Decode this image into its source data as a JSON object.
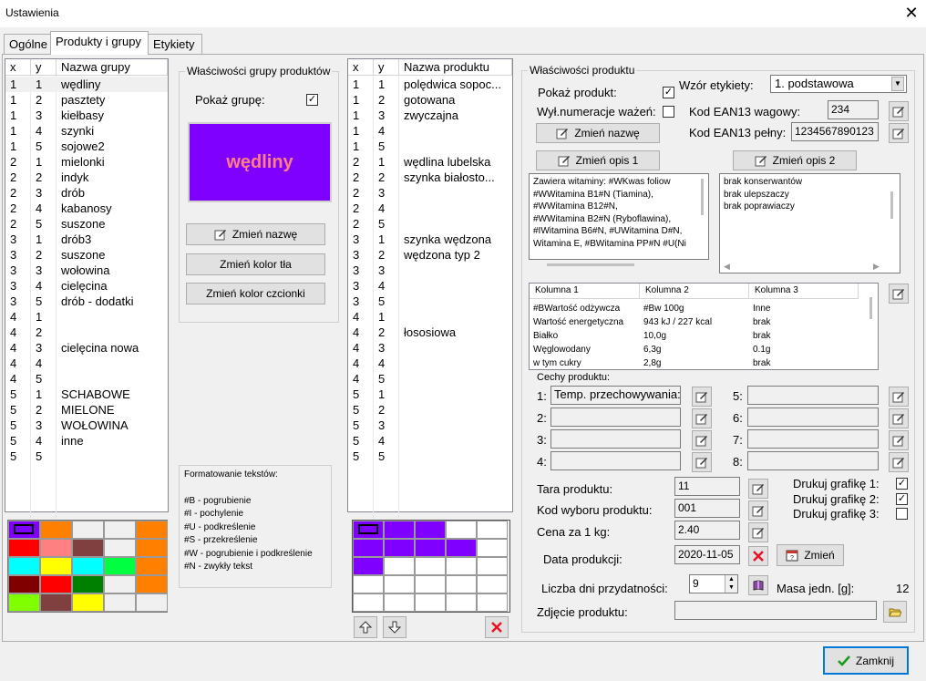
{
  "window": {
    "title": "Ustawienia",
    "close_glyph": "✕"
  },
  "tabs": [
    "Ogólne",
    "Produkty i grupy",
    "Etykiety"
  ],
  "groups_grid": {
    "headers": [
      "x",
      "y",
      "Nazwa grupy"
    ],
    "rows": [
      [
        "1",
        "1",
        "wędliny"
      ],
      [
        "1",
        "2",
        "pasztety"
      ],
      [
        "1",
        "3",
        "kiełbasy"
      ],
      [
        "1",
        "4",
        "szynki"
      ],
      [
        "1",
        "5",
        "sojowe2"
      ],
      [
        "2",
        "1",
        "mielonki"
      ],
      [
        "2",
        "2",
        "indyk"
      ],
      [
        "2",
        "3",
        "drób"
      ],
      [
        "2",
        "4",
        "kabanosy"
      ],
      [
        "2",
        "5",
        "suszone"
      ],
      [
        "3",
        "1",
        "drób3"
      ],
      [
        "3",
        "2",
        "suszone"
      ],
      [
        "3",
        "3",
        "wołowina"
      ],
      [
        "3",
        "4",
        "cielęcina"
      ],
      [
        "3",
        "5",
        "drób - dodatki"
      ],
      [
        "4",
        "1",
        ""
      ],
      [
        "4",
        "2",
        ""
      ],
      [
        "4",
        "3",
        "cielęcina nowa"
      ],
      [
        "4",
        "4",
        ""
      ],
      [
        "4",
        "5",
        ""
      ],
      [
        "5",
        "1",
        "SCHABOWE"
      ],
      [
        "5",
        "2",
        "MIELONE"
      ],
      [
        "5",
        "3",
        "WOŁOWINA"
      ],
      [
        "5",
        "4",
        "inne"
      ],
      [
        "5",
        "5",
        ""
      ]
    ]
  },
  "group_props": {
    "title": "Właściwości grupy produktów",
    "show_label": "Pokaż grupę:",
    "show_checked": "✓",
    "preview_text": "wędliny",
    "preview_bg": "#8000ff",
    "preview_fg": "#ff8080",
    "btn_rename": "Zmień nazwę",
    "btn_bg": "Zmień kolor tła",
    "btn_font": "Zmień kolor czcionki"
  },
  "format_help": {
    "lines": [
      "Formatowanie tekstów:",
      "",
      "#B - pogrubienie",
      "#I - pochylenie",
      "#U - podkreślenie",
      "#S - przekreślenie",
      "#W - pogrubienie i podkreślenie",
      "#N - zwykły tekst"
    ]
  },
  "group_palette": [
    [
      "#8000ff",
      "#ff8000",
      "#f0f0f0",
      "#f0f0f0",
      "#ff8000"
    ],
    [
      "#ff0000",
      "#ff8080",
      "#804040",
      "#f0f0f0",
      "#ff8000"
    ],
    [
      "#00ffff",
      "#ffff00",
      "#00ffff",
      "#00ff40",
      "#ff8000"
    ],
    [
      "#800000",
      "#ff0000",
      "#008000",
      "#f0f0f0",
      "#ff8000"
    ],
    [
      "#80ff00",
      "#804040",
      "#ffff00",
      "#f0f0f0",
      "#f0f0f0"
    ]
  ],
  "products_grid": {
    "headers": [
      "x",
      "y",
      "Nazwa produktu"
    ],
    "rows": [
      [
        "1",
        "1",
        "polędwica sopoc..."
      ],
      [
        "1",
        "2",
        "gotowana"
      ],
      [
        "1",
        "3",
        "zwyczajna"
      ],
      [
        "1",
        "4",
        ""
      ],
      [
        "1",
        "5",
        ""
      ],
      [
        "2",
        "1",
        "wędlina lubelska"
      ],
      [
        "2",
        "2",
        "szynka białosto..."
      ],
      [
        "2",
        "3",
        ""
      ],
      [
        "2",
        "4",
        ""
      ],
      [
        "2",
        "5",
        ""
      ],
      [
        "3",
        "1",
        "szynka wędzona"
      ],
      [
        "3",
        "2",
        "wędzona typ 2"
      ],
      [
        "3",
        "3",
        ""
      ],
      [
        "3",
        "4",
        ""
      ],
      [
        "3",
        "5",
        ""
      ],
      [
        "4",
        "1",
        ""
      ],
      [
        "4",
        "2",
        "łososiowa"
      ],
      [
        "4",
        "3",
        ""
      ],
      [
        "4",
        "4",
        ""
      ],
      [
        "4",
        "5",
        ""
      ],
      [
        "5",
        "1",
        ""
      ],
      [
        "5",
        "2",
        ""
      ],
      [
        "5",
        "3",
        ""
      ],
      [
        "5",
        "4",
        ""
      ],
      [
        "5",
        "5",
        ""
      ]
    ]
  },
  "product_palette": [
    [
      "#8000ff",
      "#8000ff",
      "#8000ff",
      "#ffffff",
      "#ffffff"
    ],
    [
      "#8000ff",
      "#8000ff",
      "#8000ff",
      "#8000ff",
      "#ffffff"
    ],
    [
      "#8000ff",
      "#ffffff",
      "#ffffff",
      "#ffffff",
      "#ffffff"
    ],
    [
      "#ffffff",
      "#ffffff",
      "#ffffff",
      "#ffffff",
      "#ffffff"
    ],
    [
      "#ffffff",
      "#ffffff",
      "#ffffff",
      "#ffffff",
      "#ffffff"
    ]
  ],
  "product_props": {
    "title": "Właściwości produktu",
    "show_label": "Pokaż produkt:",
    "show_checked": "✓",
    "weigh_label": "Wył.numeracje ważeń:",
    "weigh_checked": "",
    "label_pattern_label": "Wzór etykiety:",
    "label_pattern_value": "1. podstawowa",
    "ean_weight_label": "Kod EAN13 wagowy:",
    "ean_weight_value": "234",
    "ean_full_label": "Kod EAN13 pełny:",
    "ean_full_value": "1234567890123",
    "btn_rename": "Zmień nazwę",
    "btn_desc1": "Zmień opis 1",
    "btn_desc2": "Zmień opis 2",
    "desc1_lines": [
      "Zawiera witaminy: #WKwas foliow",
      "#WWitamina B1#N (Tiamina),",
      "#WWitamina B12#N,",
      "#WWitamina B2#N (Ryboflawina),",
      "#IWitamina B6#N, #UWitamina D#N,",
      "Witamina E, #BWitamina PP#N #U(Ni"
    ],
    "desc2_lines": [
      "brak konserwantów",
      "brak ulepszaczy",
      "brak poprawiaczy"
    ],
    "nutrition": {
      "headers": [
        "Kolumna 1",
        "Kolumna 2",
        "Kolumna 3"
      ],
      "rows": [
        [
          "#BWartość odżywcza",
          "#Bw 100g",
          "Inne"
        ],
        [
          "Wartość energetyczna",
          "943 kJ / 227 kcal",
          "brak"
        ],
        [
          "Białko",
          "10,0g",
          "brak"
        ],
        [
          "Węglowodany",
          "6,3g",
          "0.1g"
        ],
        [
          "w tym cukry",
          "2,8g",
          "brak"
        ]
      ]
    },
    "features_title": "Cechy produktu:",
    "features": [
      {
        "n": "1:",
        "v": "Temp. przechowywania:"
      },
      {
        "n": "2:",
        "v": ""
      },
      {
        "n": "3:",
        "v": ""
      },
      {
        "n": "4:",
        "v": ""
      },
      {
        "n": "5:",
        "v": ""
      },
      {
        "n": "6:",
        "v": ""
      },
      {
        "n": "7:",
        "v": ""
      },
      {
        "n": "8:",
        "v": ""
      }
    ],
    "tara_label": "Tara produktu:",
    "tara_value": "11",
    "code_label": "Kod wyboru produktu:",
    "code_value": "001",
    "price_label": "Cena za 1 kg:",
    "price_value": "2.40",
    "date_label": "Data produkcji:",
    "date_value": "2020-11-05",
    "btn_change": "Zmień",
    "days_label": "Liczba dni przydatności:",
    "days_value": "9",
    "mass_label": "Masa jedn. [g]:",
    "mass_value": "12",
    "photo_label": "Zdjęcie produktu:",
    "photo_value": "",
    "print1_label": "Drukuj grafikę 1:",
    "print1": "✓",
    "print2_label": "Drukuj grafikę 2:",
    "print2": "✓",
    "print3_label": "Drukuj grafikę 3:",
    "print3": ""
  },
  "footer": {
    "close_label": "Zamknij"
  },
  "colors": {
    "accent": "#8000ff",
    "check_green": "#1a9c1a",
    "delete_red": "#e81123"
  }
}
